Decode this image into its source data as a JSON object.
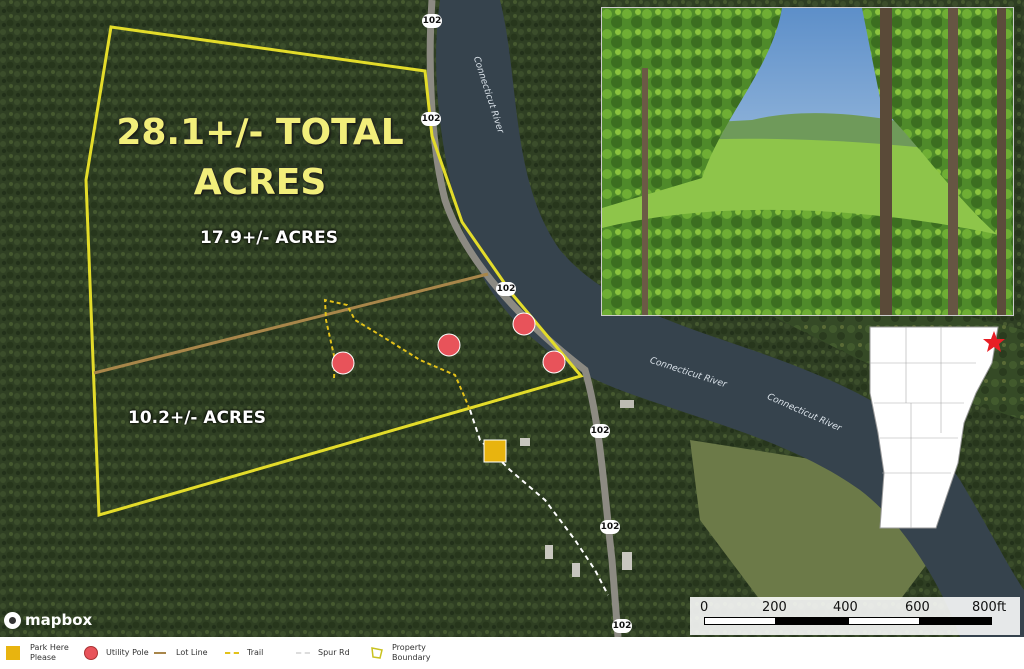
{
  "map": {
    "total_label_line1": "28.1+/- TOTAL",
    "total_label_line2": "ACRES",
    "parcel_north_label": "17.9+/- ACRES",
    "parcel_south_label": "10.2+/- ACRES",
    "road_shields": [
      "102",
      "102",
      "102",
      "102",
      "102",
      "102"
    ],
    "river_labels": [
      "Connecticut River",
      "Connecticut River",
      "Connecticut River"
    ],
    "colors": {
      "boundary": "#e3dc2a",
      "lot_line": "#a8864a",
      "trail": "#e3c21a",
      "spur": "#ffffff",
      "utility_pole": "#e8535a",
      "parking": "#e8b40f",
      "forest": "#2e3d22",
      "river": "#34404a",
      "total_label": "#f2ee7a"
    }
  },
  "scale": {
    "ticks": [
      "0",
      "200",
      "400",
      "600",
      "800ft"
    ]
  },
  "attribution": {
    "brand": "mapbox"
  },
  "inset": {
    "icon": "vermont-locator-map",
    "marker": "red-star-icon"
  },
  "photo": {
    "icon": "forest-view-photo"
  },
  "legend": {
    "items": [
      {
        "icon": "parking-square-icon",
        "label_line1": "Park Here",
        "label_line2": "Please"
      },
      {
        "icon": "utility-pole-icon",
        "label_line1": "Utility Pole",
        "label_line2": ""
      },
      {
        "icon": "lot-line-icon",
        "label_line1": "Lot Line",
        "label_line2": ""
      },
      {
        "icon": "trail-icon",
        "label_line1": "Trail",
        "label_line2": ""
      },
      {
        "icon": "spur-road-icon",
        "label_line1": "Spur Rd",
        "label_line2": ""
      },
      {
        "icon": "property-boundary-icon",
        "label_line1": "Property",
        "label_line2": "Boundary"
      }
    ]
  }
}
